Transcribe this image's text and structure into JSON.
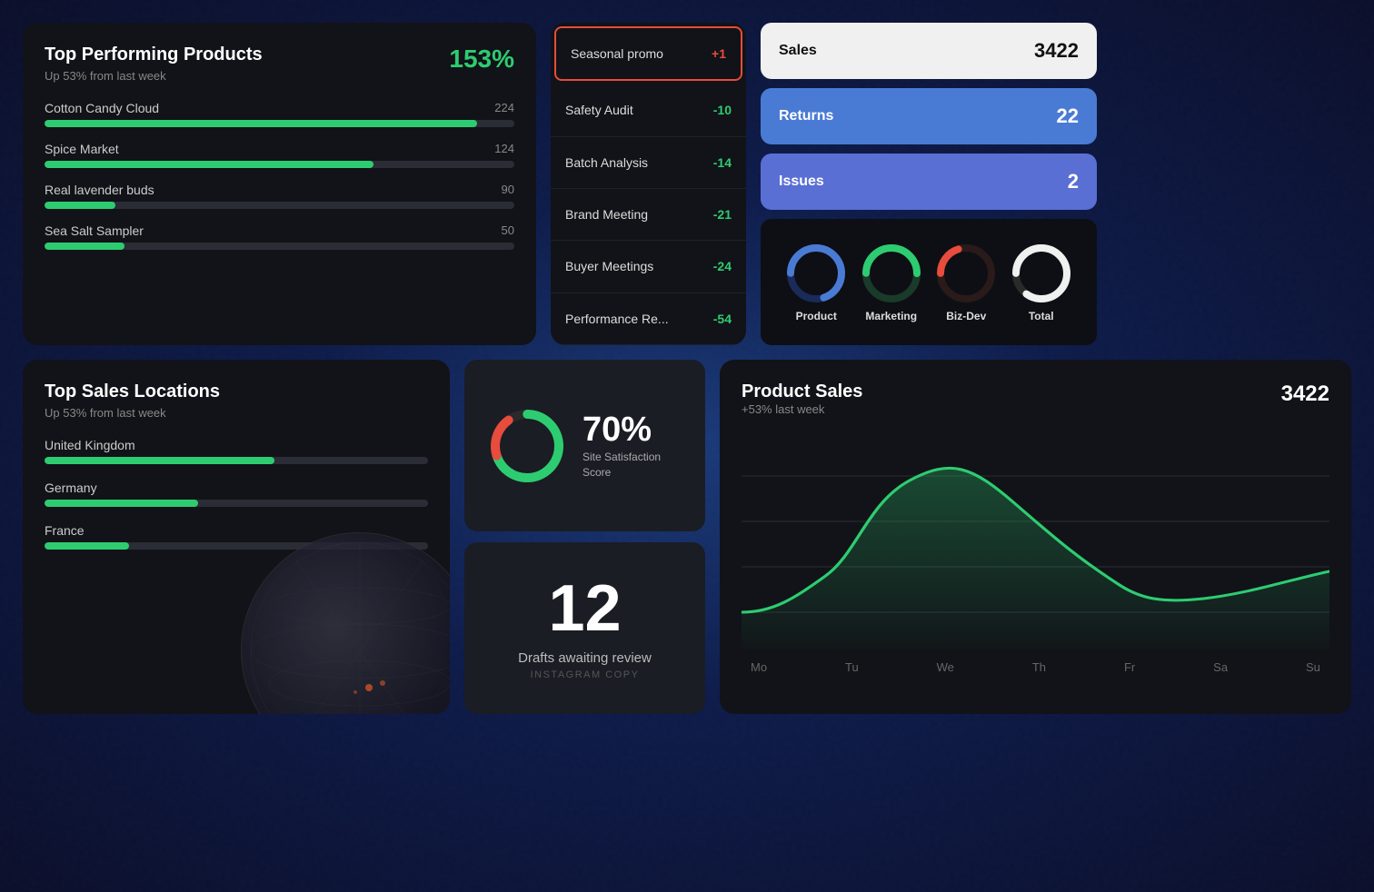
{
  "colors": {
    "green": "#2ecc71",
    "red": "#e74c3c",
    "blue": "#4a7bd4",
    "blueLight": "#5a6fd4",
    "dark": "#0d0f14",
    "card": "#111318",
    "accent": "#2ecc71"
  },
  "topProducts": {
    "title": "Top Performing Products",
    "subtitle": "Up 53% from last week",
    "percentage": "153%",
    "items": [
      {
        "name": "Cotton Candy Cloud",
        "value": 224,
        "pct": 92
      },
      {
        "name": "Spice Market",
        "value": 124,
        "pct": 70
      },
      {
        "name": "Real lavender buds",
        "value": 90,
        "pct": 15
      },
      {
        "name": "Sea Salt Sampler",
        "value": 50,
        "pct": 17
      }
    ]
  },
  "agenda": {
    "items": [
      {
        "name": "Seasonal promo",
        "delta": "+1",
        "positive": true,
        "highlighted": true
      },
      {
        "name": "Safety Audit",
        "delta": "-10",
        "positive": false
      },
      {
        "name": "Batch Analysis",
        "delta": "-14",
        "positive": false
      },
      {
        "name": "Brand Meeting",
        "delta": "-21",
        "positive": false
      },
      {
        "name": "Buyer Meetings",
        "delta": "-24",
        "positive": false
      },
      {
        "name": "Performance Re...",
        "delta": "-54",
        "positive": false
      }
    ]
  },
  "metrics": {
    "sales": {
      "label": "Sales",
      "value": "3422"
    },
    "returns": {
      "label": "Returns",
      "value": "22"
    },
    "issues": {
      "label": "Issues",
      "value": "2"
    }
  },
  "donuts": [
    {
      "label": "Product",
      "color": "#4a7bd4",
      "pct": 70,
      "trail": "#1a2a5a"
    },
    {
      "label": "Marketing",
      "color": "#2ecc71",
      "pct": 50,
      "trail": "#1a3a2a"
    },
    {
      "label": "Biz-Dev",
      "color": "#e74c3c",
      "pct": 20,
      "trail": "#2a1a1a"
    },
    {
      "label": "Total",
      "color": "#f0f0f0",
      "pct": 85,
      "trail": "#2a2a2a"
    }
  ],
  "topLocations": {
    "title": "Top Sales Locations",
    "subtitle": "Up 53% from last week",
    "items": [
      {
        "name": "United Kingdom",
        "pct": 60
      },
      {
        "name": "Germany",
        "pct": 40
      },
      {
        "name": "France",
        "pct": 22
      }
    ]
  },
  "satisfaction": {
    "percentage": "70%",
    "label": "Site Satisfaction",
    "sublabel": "Score"
  },
  "drafts": {
    "number": "12",
    "label": "Drafts awaiting review",
    "sublabel": "INSTAGRAM COPY"
  },
  "productSales": {
    "title": "Product Sales",
    "value": "3422",
    "subtitle": "+53% last week",
    "days": [
      "Mo",
      "Tu",
      "We",
      "Th",
      "Fr",
      "Sa",
      "Su"
    ]
  }
}
